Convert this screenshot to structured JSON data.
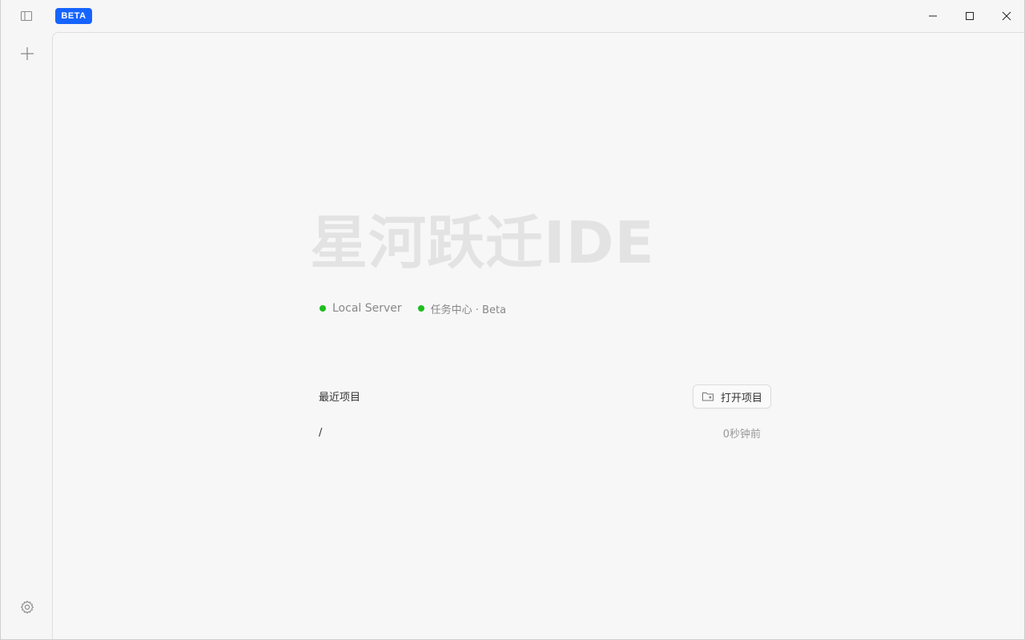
{
  "titlebar": {
    "badge": "BETA",
    "icons": {
      "sidebar_toggle": "sidebar-toggle-icon",
      "minimize": "minimize-icon",
      "maximize": "maximize-icon",
      "close": "close-icon"
    }
  },
  "rail": {
    "icons": {
      "add": "plus-icon",
      "settings": "gear-icon"
    }
  },
  "main": {
    "hero_title": "星河跃迁IDE",
    "status": [
      {
        "label": "Local Server",
        "color": "#1ebd1e"
      },
      {
        "label": "任务中心 · Beta",
        "color": "#1ebd1e"
      }
    ],
    "recent": {
      "title": "最近项目",
      "open_button": "打开项目",
      "items": [
        {
          "path": "/",
          "time": "0秒钟前"
        }
      ]
    }
  },
  "colors": {
    "accent": "#1664ff",
    "status_ok": "#1ebd1e",
    "hero_text": "#e3e3e3"
  }
}
